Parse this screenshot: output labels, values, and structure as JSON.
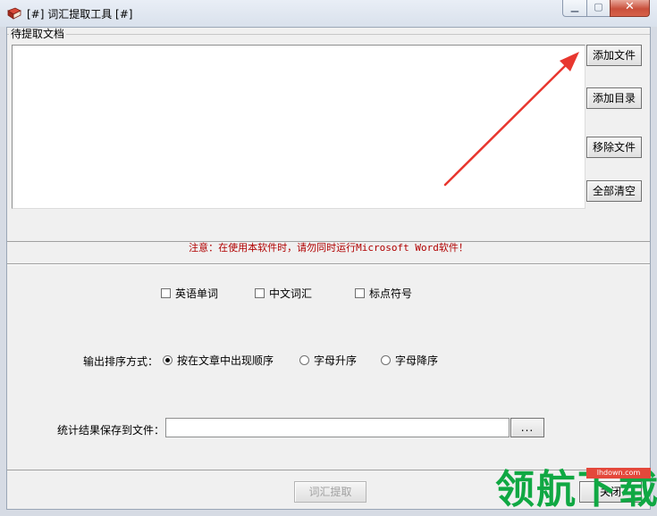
{
  "window": {
    "title": "[#] 词汇提取工具 [#]",
    "caption_buttons": [
      "minimize-icon",
      "maximize-icon",
      "close-icon"
    ]
  },
  "documents": {
    "group_label": "待提取文档",
    "items": [],
    "buttons": {
      "add_file": "添加文件",
      "add_directory": "添加目录",
      "remove_file": "移除文件",
      "clear_all": "全部清空"
    }
  },
  "notice": "注意：在使用本软件时，请勿同时运行Microsoft Word软件！",
  "options": {
    "checkboxes": [
      {
        "label": "英语单词",
        "checked": false
      },
      {
        "label": "中文词汇",
        "checked": false
      },
      {
        "label": "标点符号",
        "checked": false
      }
    ],
    "sort_label": "输出排序方式：",
    "sort_options": [
      {
        "label": "按在文章中出现顺序",
        "selected": true
      },
      {
        "label": "字母升序",
        "selected": false
      },
      {
        "label": "字母降序",
        "selected": false
      }
    ],
    "save_label": "统计结果保存到文件：",
    "save_path": "",
    "browse_label": "..."
  },
  "footer": {
    "extract_label": "词汇提取",
    "close_label": "关闭"
  },
  "watermark": {
    "text": "领航下载",
    "url": "lhdown.com"
  },
  "colors": {
    "notice": "#b00000",
    "annotation_arrow": "#e8372f",
    "watermark": "#10a843"
  }
}
